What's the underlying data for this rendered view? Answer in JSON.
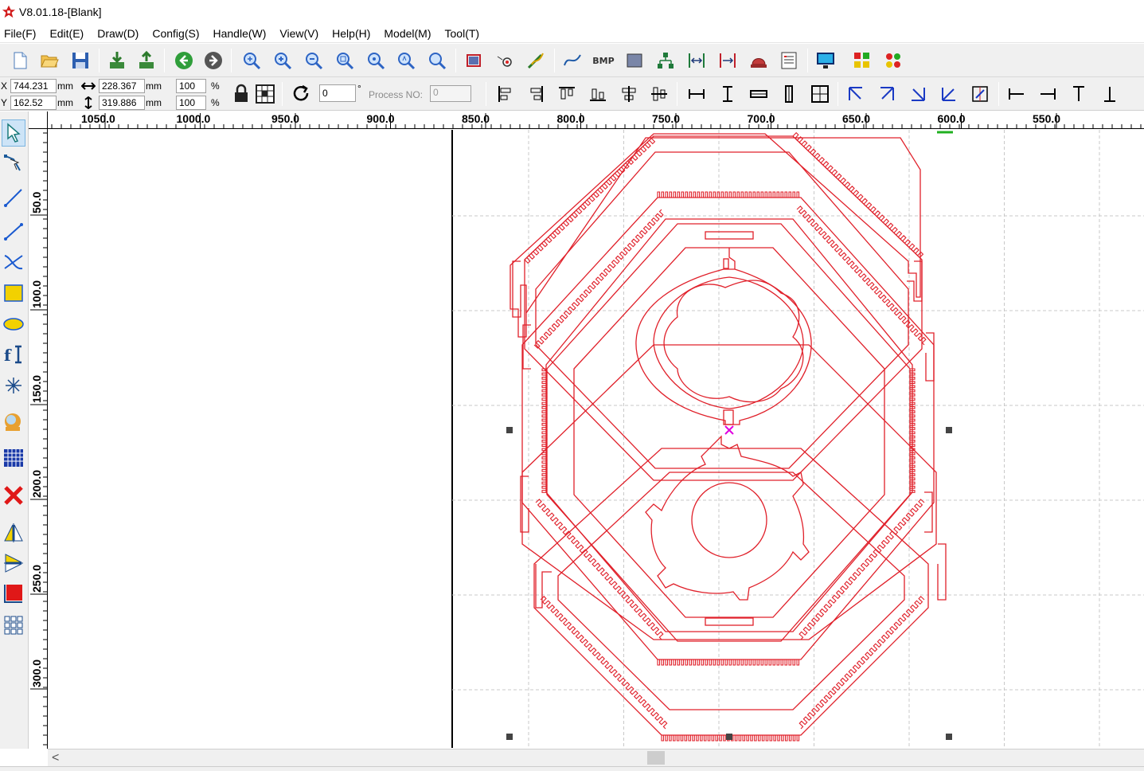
{
  "window": {
    "title": "V8.01.18-[Blank]"
  },
  "menu": [
    "File(F)",
    "Edit(E)",
    "Draw(D)",
    "Config(S)",
    "Handle(W)",
    "View(V)",
    "Help(H)",
    "Model(M)",
    "Tool(T)"
  ],
  "toolbar": {
    "icons": [
      "new-file-icon",
      "open-folder-icon",
      "save-icon",
      "import-icon",
      "export-icon",
      "back-icon",
      "forward-icon",
      "zoom-in-icon",
      "zoom-plus-icon",
      "zoom-minus-icon",
      "zoom-page-icon",
      "zoom-all-icon",
      "zoom-select-icon",
      "zoom-fit-icon",
      "select-rect-icon",
      "node-edit-icon",
      "smooth-icon",
      "curve-icon",
      "bitmap-icon",
      "rect-fill-icon",
      "tree-icon",
      "h-center-icon",
      "v-center-icon",
      "laser-head-icon",
      "layer-list-icon",
      "monitor-icon",
      "array-icon",
      "array-copy-icon"
    ],
    "bmp_label": "BMP"
  },
  "position": {
    "x_label": "X",
    "x_value": "744.231",
    "x_unit": "mm",
    "y_label": "Y",
    "y_value": "162.52",
    "y_unit": "mm",
    "w_value": "228.367",
    "w_unit": "mm",
    "h_value": "319.886",
    "h_unit": "mm",
    "scale_x": "100",
    "scale_y": "100",
    "percent": "%",
    "rotate_value": "0",
    "degree": "°",
    "process_no_label": "Process NO:",
    "process_no_value": "0"
  },
  "rulers": {
    "horizontal": [
      "1050.0",
      "1000.0",
      "950.0",
      "900.0",
      "850.0",
      "800.0",
      "750.0",
      "700.0",
      "650.0",
      "600.0",
      "550.0"
    ],
    "vertical": [
      "50.0",
      "100.0",
      "150.0",
      "200.0",
      "250.0",
      "300.0"
    ]
  },
  "left_tools": [
    "select-tool-icon",
    "node-tool-icon",
    "line-tool-icon",
    "polyline-tool-icon",
    "curve-tool-icon",
    "rectangle-tool-icon",
    "ellipse-tool-icon",
    "text-tool-icon",
    "point-tool-icon",
    "camera-tool-icon",
    "grid-tool-icon",
    "delete-tool-icon",
    "mirror-h-icon",
    "mirror-v-icon",
    "fill-tool-icon",
    "array-tool-icon"
  ],
  "colors": {
    "cut_line": "#e0202a",
    "selection_center": "#e000e0",
    "grid": "#c8c8c8"
  },
  "scrollbar": {
    "left_arrow": "<"
  }
}
